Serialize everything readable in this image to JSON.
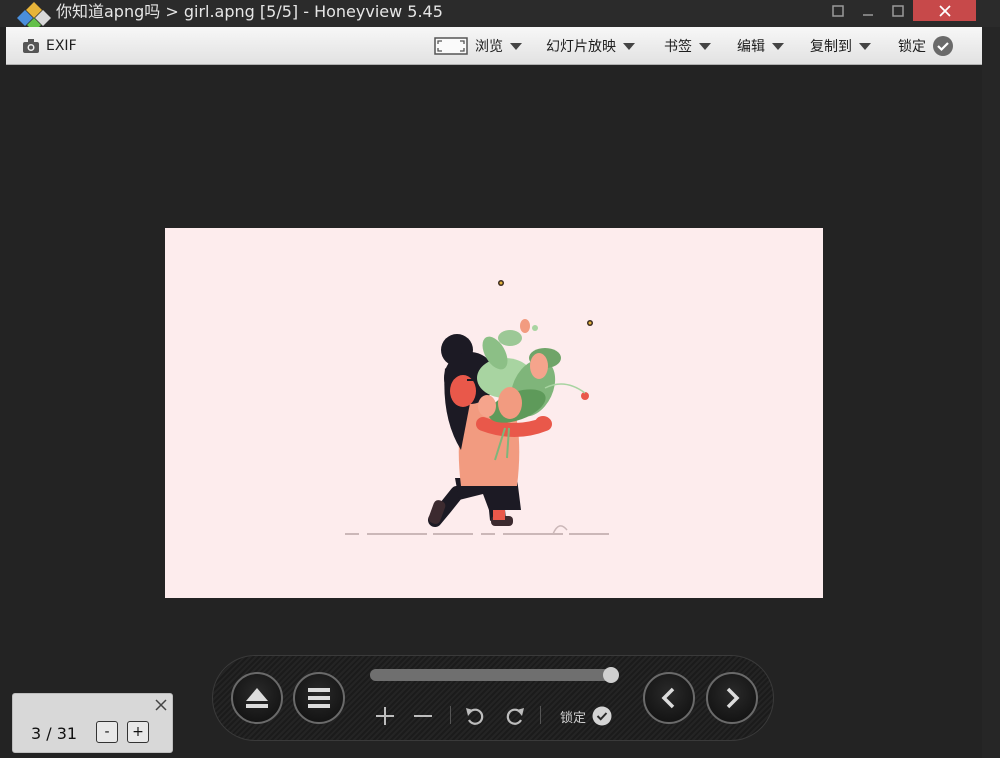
{
  "window": {
    "title": "你知道apng吗 > girl.apng [5/5] - Honeyview 5.45"
  },
  "menubar": {
    "exif": "EXIF",
    "browse": "浏览",
    "slideshow": "幻灯片放映",
    "bookmarks": "书签",
    "edit": "编辑",
    "copy_to": "复制到",
    "lock": "锁定"
  },
  "controls": {
    "lock": "锁定",
    "progress_fraction": 0.97
  },
  "page_popup": {
    "counter": "3 / 31",
    "decrement": "-",
    "increment": "+"
  },
  "colors": {
    "close_button": "#c7494a",
    "canvas_background": "#fdeced",
    "app_background": "#232323"
  },
  "icons": [
    "app-logo",
    "camera-icon",
    "fit-screen-icon",
    "check-circle-icon",
    "eject-icon",
    "menu-list-icon",
    "plus-icon",
    "minus-icon",
    "rotate-left-icon",
    "rotate-right-icon",
    "chevron-left-icon",
    "chevron-right-icon",
    "close-icon"
  ]
}
